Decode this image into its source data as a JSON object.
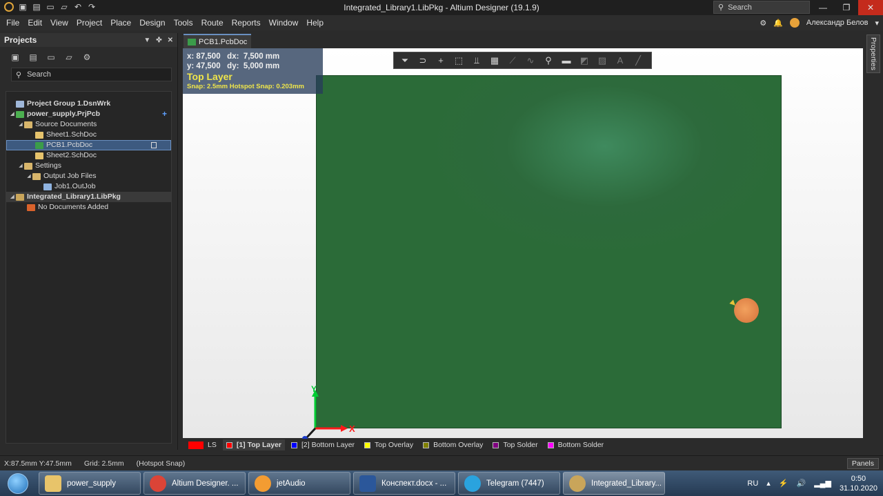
{
  "titlebar": {
    "title": "Integrated_Library1.LibPkg - Altium Designer (19.1.9)",
    "search_placeholder": "Search",
    "icons": [
      "altium-logo-icon",
      "save-icon",
      "save-all-icon",
      "open-icon",
      "open-project-icon",
      "undo-icon",
      "redo-icon"
    ]
  },
  "menu": {
    "items": [
      "File",
      "Edit",
      "View",
      "Project",
      "Place",
      "Design",
      "Tools",
      "Route",
      "Reports",
      "Window",
      "Help"
    ],
    "user": "Александр Белов"
  },
  "projects_panel": {
    "title": "Projects",
    "search_placeholder": "Search",
    "tree": [
      {
        "label": "Project Group 1.DsnWrk",
        "level": 0,
        "icon": "workspace-icon",
        "bold": true
      },
      {
        "label": "power_supply.PrjPcb",
        "level": 0,
        "icon": "pcb-project-icon",
        "bold": true,
        "expanded": true
      },
      {
        "label": "Source Documents",
        "level": 1,
        "icon": "folder-icon",
        "expanded": true
      },
      {
        "label": "Sheet1.SchDoc",
        "level": 2,
        "icon": "schematic-icon"
      },
      {
        "label": "PCB1.PcbDoc",
        "level": 2,
        "icon": "pcb-doc-icon",
        "selected": true
      },
      {
        "label": "Sheet2.SchDoc",
        "level": 2,
        "icon": "schematic-icon"
      },
      {
        "label": "Settings",
        "level": 1,
        "icon": "folder-icon",
        "expanded": true
      },
      {
        "label": "Output Job Files",
        "level": 2,
        "icon": "folder-icon",
        "expanded": true
      },
      {
        "label": "Job1.OutJob",
        "level": 3,
        "icon": "outjob-icon"
      },
      {
        "label": "Integrated_Library1.LibPkg",
        "level": 0,
        "icon": "library-package-icon",
        "bold": true,
        "expanded": true
      },
      {
        "label": "No Documents Added",
        "level": 1,
        "icon": "empty-folder-icon"
      }
    ]
  },
  "document_tab": {
    "label": "PCB1.PcbDoc"
  },
  "hud": {
    "coords_line1": "x: 87,500   dx:  7,500 mm",
    "coords_line2": "y: 47,500   dy:  5,000 mm",
    "layer": "Top Layer",
    "snap": "Snap: 2.5mm Hotspot Snap: 0.203mm"
  },
  "axis_labels": {
    "y": "Y",
    "x": "X"
  },
  "layers": [
    {
      "label": "LS",
      "color": "#ff0000"
    },
    {
      "label": "[1] Top Layer",
      "color": "#ff0000",
      "active": true
    },
    {
      "label": "[2] Bottom Layer",
      "color": "#0000ff"
    },
    {
      "label": "Top Overlay",
      "color": "#ffff00"
    },
    {
      "label": "Bottom Overlay",
      "color": "#808000"
    },
    {
      "label": "Top Solder",
      "color": "#800080"
    },
    {
      "label": "Bottom Solder",
      "color": "#ff00ff"
    }
  ],
  "status": {
    "coords": "X:87.5mm Y:47.5mm",
    "grid": "Grid: 2.5mm",
    "snap_mode": "(Hotspot Snap)",
    "panels_label": "Panels"
  },
  "properties_tab": {
    "label": "Properties"
  },
  "taskbar": {
    "tasks": [
      {
        "label": "power_supply",
        "icon": "folder-icon",
        "color": "#e8c46a"
      },
      {
        "label": "Altium Designer. ...",
        "icon": "chrome-icon",
        "color": "#db4437"
      },
      {
        "label": "jetAudio",
        "icon": "jetaudio-icon",
        "color": "#f39c32"
      },
      {
        "label": "Конспект.docx - ...",
        "icon": "word-icon",
        "color": "#2b579a"
      },
      {
        "label": "Telegram (7447)",
        "icon": "telegram-icon",
        "color": "#2aa3de"
      },
      {
        "label": "Integrated_Library...",
        "icon": "altium-icon",
        "color": "#c9a55a"
      }
    ],
    "language": "RU",
    "time": "0:50",
    "date": "31.10.2020"
  },
  "colors": {
    "board": "#2d6a3c",
    "pad": "#e8874a",
    "hud_layer": "#f0e64a",
    "selection": "#3d5a80"
  }
}
